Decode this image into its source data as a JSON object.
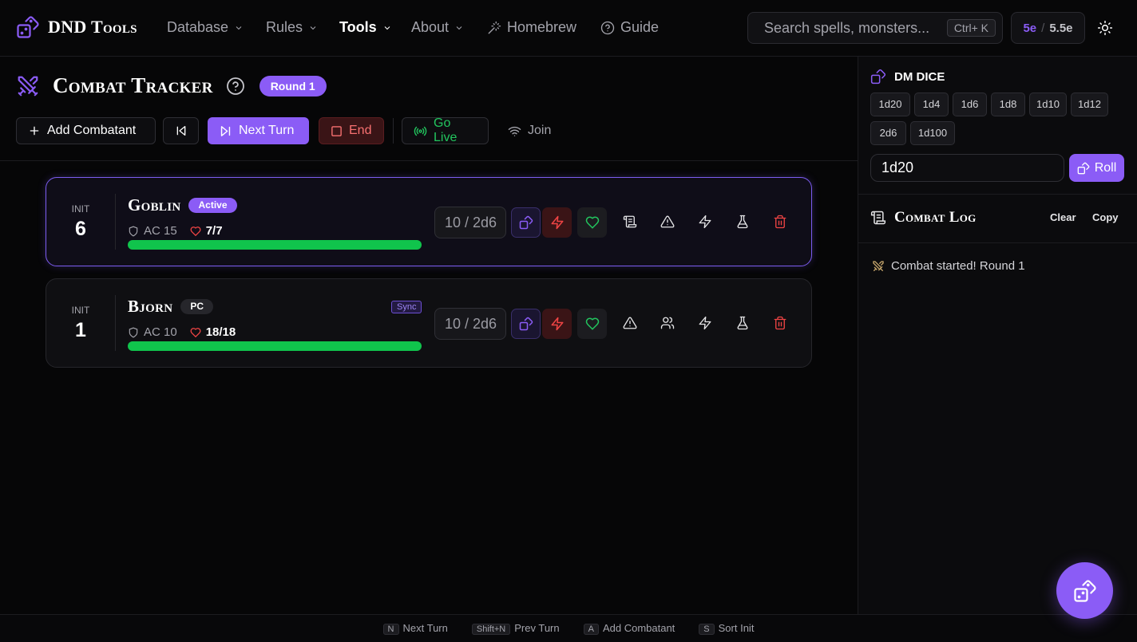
{
  "app": {
    "name": "DND Tools"
  },
  "nav": {
    "database": "Database",
    "rules": "Rules",
    "tools": "Tools",
    "about": "About",
    "homebrew": "Homebrew",
    "guide": "Guide"
  },
  "search": {
    "placeholder": "Search spells, monsters...",
    "shortcut": "Ctrl+ K"
  },
  "edition": {
    "a": "5e",
    "sep": "/",
    "b": "5.5e"
  },
  "tracker": {
    "title": "Combat Tracker",
    "round": "Round 1",
    "buttons": {
      "add": "Add Combatant",
      "next": "Next Turn",
      "end": "End",
      "live": "Go Live",
      "join": "Join"
    }
  },
  "combatants": [
    {
      "init_label": "INIT",
      "init": "6",
      "name": "Goblin",
      "badge": "Active",
      "ac": "AC 15",
      "hp": "7/7",
      "hp_fraction": 1.0,
      "hp_input": "10 / 2d6"
    },
    {
      "init_label": "INIT",
      "init": "1",
      "name": "Bjorn",
      "badge": "PC",
      "sync": "Sync",
      "ac": "AC 10",
      "hp": "18/18",
      "hp_fraction": 1.0,
      "hp_input": "10 / 2d6"
    }
  ],
  "dice": {
    "title": "DM DICE",
    "buttons": [
      "1d20",
      "1d4",
      "1d6",
      "1d8",
      "1d10",
      "1d12",
      "2d6",
      "1d100"
    ],
    "input": "1d20",
    "roll": "Roll"
  },
  "log": {
    "title": "Combat Log",
    "clear": "Clear",
    "copy": "Copy",
    "entries": [
      "Combat started! Round 1"
    ]
  },
  "footer": [
    {
      "key": "N",
      "label": "Next Turn"
    },
    {
      "key": "Shift+N",
      "label": "Prev Turn"
    },
    {
      "key": "A",
      "label": "Add Combatant"
    },
    {
      "key": "S",
      "label": "Sort Init"
    }
  ],
  "colors": {
    "accent": "#8b5cf6",
    "danger": "#ef4444",
    "success": "#22c55e",
    "hp": "#10c44c"
  }
}
